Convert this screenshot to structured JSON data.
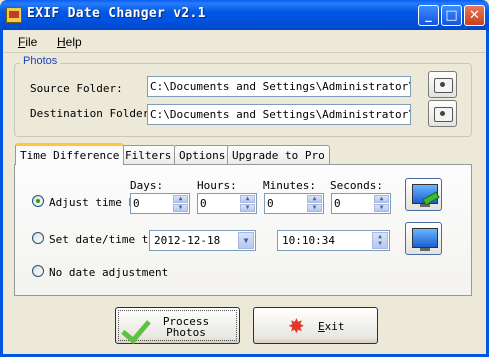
{
  "window": {
    "title": "EXIF Date Changer v2.1"
  },
  "title_buttons": {
    "minimize": "_",
    "maximize": "□",
    "close": "✕"
  },
  "menu": {
    "file": {
      "accel": "F",
      "rest": "ile"
    },
    "help": {
      "accel": "H",
      "rest": "elp"
    }
  },
  "photos": {
    "group_label": "Photos",
    "source_label": "Source Folder:",
    "source_value": "C:\\Documents and Settings\\Administrator\\My",
    "destination_label": "Destination Folder:",
    "destination_value": "C:\\Documents and Settings\\Administrator\\My"
  },
  "tabs": [
    "Time Difference",
    "Filters",
    "Options",
    "Upgrade to Pro"
  ],
  "time_difference": {
    "adjust_label": "Adjust time by",
    "setdate_label": "Set date/time to:",
    "none_label": "No date adjustment",
    "selected": "adjust",
    "columns": {
      "days": "Days:",
      "hours": "Hours:",
      "minutes": "Minutes:",
      "seconds": "Seconds:"
    },
    "values": {
      "days": "0",
      "hours": "0",
      "minutes": "0",
      "seconds": "0"
    },
    "date_value": "2012-12-18",
    "time_value": "10:10:34"
  },
  "buttons": {
    "process": "Process Photos",
    "process_line1": "Process",
    "process_line2": "Photos",
    "exit_accel": "E",
    "exit_rest": "xit"
  },
  "icons": {
    "app": "app-icon",
    "browse": "camera-folder-icon",
    "apply_adjust": "monitor-check-icon",
    "apply_setdate": "monitor-magnify-icon",
    "process": "green-check-icon",
    "exit": "red-burst-icon"
  },
  "colors": {
    "titlebar": "#0058e6",
    "group_label": "#1a3fc2",
    "active_tab_accent": "#ffc83c"
  }
}
